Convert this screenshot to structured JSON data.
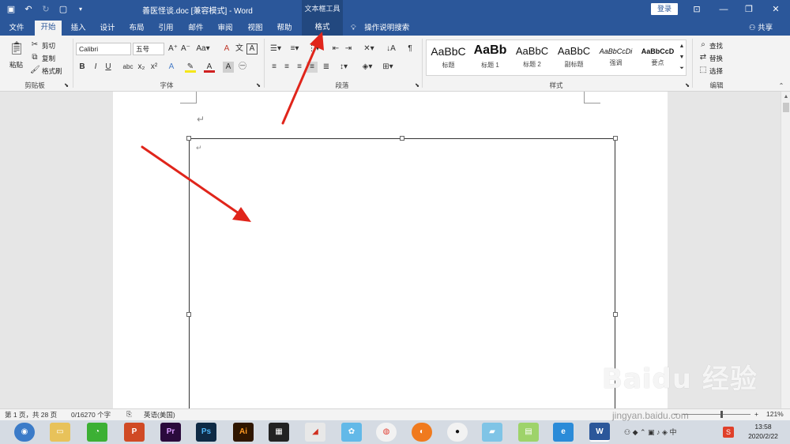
{
  "titlebar": {
    "doc_title": "善医怪谈.doc [兼容模式]  -  Word",
    "context_label": "文本框工具",
    "login": "登录",
    "qat_save_icon": "save-icon",
    "qat_undo_icon": "undo-icon"
  },
  "tabs": [
    {
      "label": "文件"
    },
    {
      "label": "开始"
    },
    {
      "label": "插入"
    },
    {
      "label": "设计"
    },
    {
      "label": "布局"
    },
    {
      "label": "引用"
    },
    {
      "label": "邮件"
    },
    {
      "label": "审阅"
    },
    {
      "label": "视图"
    },
    {
      "label": "帮助"
    },
    {
      "label": "格式"
    }
  ],
  "tell_me": "操作说明搜索",
  "share": "共享",
  "clipboard": {
    "paste": "粘贴",
    "cut": "剪切",
    "copy": "复制",
    "format_painter": "格式刷",
    "group": "剪贴板"
  },
  "font": {
    "name": "Calibri",
    "size": "五号",
    "group": "字体"
  },
  "paragraph": {
    "group": "段落"
  },
  "styles": {
    "group": "样式",
    "items": [
      {
        "sample": "AaBbC",
        "name": "标题"
      },
      {
        "sample": "AaBb",
        "name": "标题 1"
      },
      {
        "sample": "AaBbC",
        "name": "标题 2"
      },
      {
        "sample": "AaBbC",
        "name": "副标题"
      },
      {
        "sample": "AaBbCcDi",
        "name": "强调"
      },
      {
        "sample": "AaBbCcD",
        "name": "要点"
      }
    ]
  },
  "editing": {
    "find": "查找",
    "replace": "替换",
    "select": "选择",
    "group": "编辑"
  },
  "statusbar": {
    "page": "第 1 页，共 28 页",
    "words": "0/16270 个字",
    "language": "英语(美国)",
    "zoom": "121%"
  },
  "taskbar": {
    "time": "13:58",
    "date": "2020/2/22"
  },
  "watermark": {
    "text": "Baidu 经验",
    "url": "jingyan.baidu.com"
  },
  "colors": {
    "word_blue": "#2b579a",
    "arrow_red": "#e0251b"
  }
}
